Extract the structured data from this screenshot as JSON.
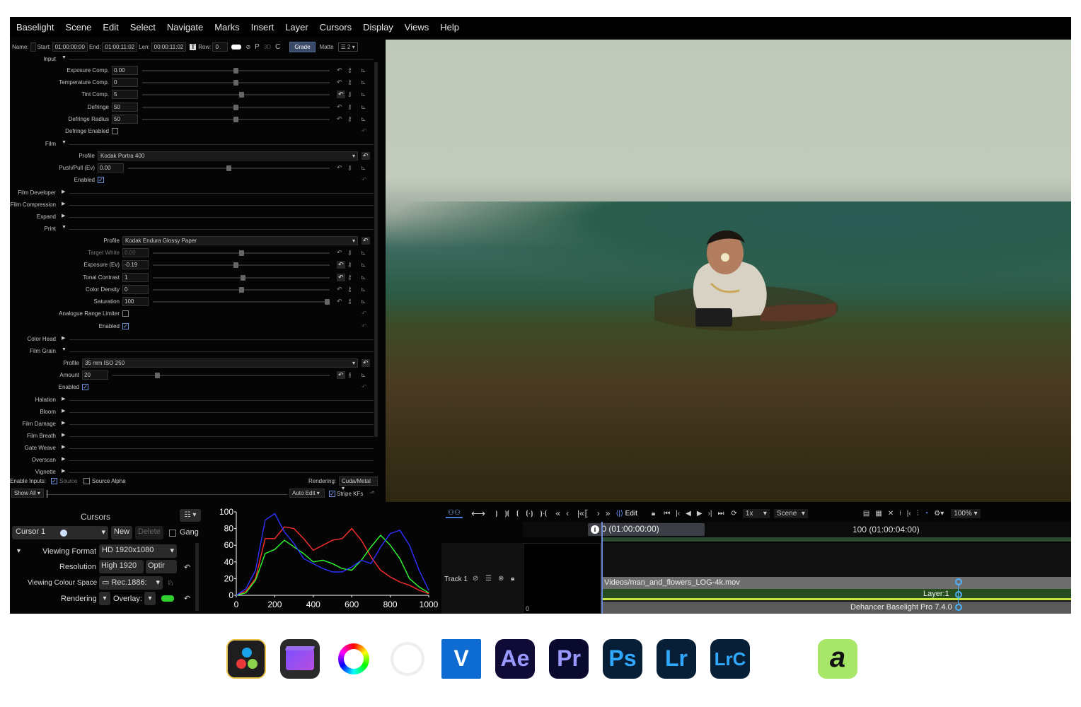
{
  "menu": [
    "Baselight",
    "Scene",
    "Edit",
    "Select",
    "Navigate",
    "Marks",
    "Insert",
    "Layer",
    "Cursors",
    "Display",
    "Views",
    "Help"
  ],
  "toolbar": {
    "name_label": "Name:",
    "start_label": "Start:",
    "start": "01:00:00:00",
    "end_label": "End:",
    "end": "01:00:11:02",
    "len_label": "Len:",
    "len": "00:00:11:02",
    "row_label": "Row:",
    "row": "0",
    "p": "P",
    "three_d": "3D",
    "c": "C",
    "grade": "Grade",
    "matte": "Matte",
    "count": "2"
  },
  "rows": [
    {
      "type": "section",
      "label": "Input",
      "open": true,
      "y": 0
    },
    {
      "type": "param",
      "label": "Exposure Comp.",
      "value": "0.00",
      "knob": 0.5,
      "y": 16,
      "lx": 140,
      "reset_on": false
    },
    {
      "type": "param",
      "label": "Temperature Comp.",
      "value": "0",
      "knob": 0.5,
      "y": 33,
      "lx": 140,
      "reset_on": false
    },
    {
      "type": "param",
      "label": "Tint Comp.",
      "value": "5",
      "knob": 0.53,
      "y": 50,
      "lx": 140,
      "reset_on": true
    },
    {
      "type": "param",
      "label": "Defringe",
      "value": "50",
      "knob": 0.5,
      "y": 68,
      "lx": 140,
      "reset_on": false
    },
    {
      "type": "param",
      "label": "Defringe Radius",
      "value": "50",
      "knob": 0.5,
      "y": 85,
      "lx": 140,
      "reset_on": false
    },
    {
      "type": "check",
      "label": "Defringe Enabled",
      "checked": false,
      "y": 102,
      "lx": 140
    },
    {
      "type": "section",
      "label": "Film",
      "open": true,
      "y": 120
    },
    {
      "type": "select",
      "label": "Profile",
      "value": "Kodak Portra 400",
      "y": 137,
      "lx": 120
    },
    {
      "type": "param",
      "label": "Push/Pull (Ev)",
      "value": "0.00",
      "knob": 0.5,
      "y": 154,
      "lx": 120,
      "reset_on": false
    },
    {
      "type": "check",
      "label": "Enabled",
      "checked": true,
      "y": 171,
      "lx": 120
    },
    {
      "type": "section",
      "label": "Film Developer",
      "open": false,
      "y": 189
    },
    {
      "type": "section",
      "label": "Film Compression",
      "open": false,
      "y": 206
    },
    {
      "type": "section",
      "label": "Expand",
      "open": false,
      "y": 223
    },
    {
      "type": "section",
      "label": "Print",
      "open": true,
      "y": 240
    },
    {
      "type": "select",
      "label": "Profile",
      "value": "Kodak Endura Glossy Paper",
      "y": 257,
      "lx": 155
    },
    {
      "type": "param",
      "label": "Target White",
      "value": "0.00",
      "knob": 0.5,
      "y": 274,
      "lx": 155,
      "reset_on": false,
      "dim": true
    },
    {
      "type": "param",
      "label": "Exposure (Ev)",
      "value": "-0.19",
      "knob": 0.47,
      "y": 291,
      "lx": 155,
      "reset_on": true
    },
    {
      "type": "param",
      "label": "Tonal Contrast",
      "value": "1",
      "knob": 0.51,
      "y": 309,
      "lx": 155,
      "reset_on": true
    },
    {
      "type": "param",
      "label": "Color Density",
      "value": "0",
      "knob": 0.5,
      "y": 326,
      "lx": 155,
      "reset_on": false
    },
    {
      "type": "param",
      "label": "Saturation",
      "value": "100",
      "knob": 1.0,
      "y": 343,
      "lx": 155,
      "reset_on": false
    },
    {
      "type": "check",
      "label": "Analogue Range Limiter",
      "checked": false,
      "y": 360,
      "lx": 155
    },
    {
      "type": "check",
      "label": "Enabled",
      "checked": true,
      "y": 378,
      "lx": 155
    },
    {
      "type": "section",
      "label": "Color Head",
      "open": false,
      "y": 396
    },
    {
      "type": "section",
      "label": "Film Grain",
      "open": true,
      "y": 413
    },
    {
      "type": "select",
      "label": "Profile",
      "value": "35 mm ISO 250",
      "y": 430,
      "lx": 98
    },
    {
      "type": "param",
      "label": "Amount",
      "value": "20",
      "knob": 0.2,
      "y": 447,
      "lx": 98,
      "reset_on": true
    },
    {
      "type": "check",
      "label": "Enabled",
      "checked": true,
      "y": 464,
      "lx": 98
    },
    {
      "type": "section",
      "label": "Halation",
      "open": false,
      "y": 482
    },
    {
      "type": "section",
      "label": "Bloom",
      "open": false,
      "y": 499
    },
    {
      "type": "section",
      "label": "Film Damage",
      "open": false,
      "y": 516
    },
    {
      "type": "section",
      "label": "Film Breath",
      "open": false,
      "y": 533
    },
    {
      "type": "section",
      "label": "Gate Weave",
      "open": false,
      "y": 550
    },
    {
      "type": "section",
      "label": "Overscan",
      "open": false,
      "y": 567
    },
    {
      "type": "section",
      "label": "Vignette",
      "open": false,
      "y": 584
    }
  ],
  "bottom": {
    "enable_inputs": "Enable Inputs:",
    "source": "Source",
    "source_alpha": "Source Alpha",
    "rendering_label": "Rendering:",
    "rendering": "Cuda/Metal",
    "show_all": "Show All",
    "auto_edit": "Auto Edit",
    "stripe": "Stripe KFs"
  },
  "cursors": {
    "title": "Cursors",
    "cursor": "Cursor 1",
    "new": "New",
    "delete": "Delete",
    "gang": "Gang",
    "viewing_format_label": "Viewing Format",
    "viewing_format": "HD 1920x1080",
    "resolution_label": "Resolution",
    "resolution": "High 1920",
    "resolution_opt": "Optir",
    "colour_space_label": "Viewing Colour Space",
    "colour_space": "Rec.1886:",
    "rendering_label": "Rendering",
    "overlay_label": "Overlay:"
  },
  "histogram": {
    "y_ticks": [
      "100",
      "80",
      "60",
      "40",
      "20",
      "0"
    ],
    "x_ticks": [
      "0",
      "200",
      "400",
      "600",
      "800",
      "1000"
    ]
  },
  "chart_data": {
    "type": "line",
    "x": [
      0,
      50,
      100,
      150,
      200,
      250,
      300,
      350,
      400,
      450,
      500,
      550,
      600,
      650,
      700,
      750,
      800,
      850,
      900,
      950,
      1000
    ],
    "series": [
      {
        "color": "#ff3030",
        "values": [
          0,
          5,
          20,
          68,
          68,
          82,
          80,
          68,
          54,
          60,
          66,
          68,
          80,
          66,
          46,
          30,
          22,
          16,
          12,
          6,
          2
        ]
      },
      {
        "color": "#30ff30",
        "values": [
          0,
          3,
          18,
          50,
          55,
          66,
          58,
          50,
          40,
          42,
          38,
          32,
          30,
          42,
          58,
          72,
          60,
          44,
          20,
          10,
          3
        ]
      },
      {
        "color": "#3030ff",
        "values": [
          0,
          8,
          30,
          90,
          98,
          76,
          62,
          44,
          38,
          32,
          28,
          28,
          34,
          42,
          38,
          58,
          74,
          78,
          60,
          30,
          6
        ]
      }
    ],
    "xlim": [
      0,
      1000
    ],
    "ylim": [
      0,
      100
    ]
  },
  "timeline": {
    "edit": "Edit",
    "speed": "1x",
    "scene": "Scene",
    "zoom": "100%",
    "start": "0 (01:00:00:00)",
    "mid": "100 (01:00:04:00)",
    "track": "Track 1",
    "frame": "0",
    "clip": "Videos/man_and_flowers_LOG-4k.mov",
    "layer": "Layer:1",
    "effect": "Dehancer Baselight Pro 7.4.0"
  },
  "dock": [
    {
      "name": "DaVinci Resolve",
      "icon": "davinci-resolve-icon",
      "x": 320,
      "bg": "#1e1e1e",
      "txt": ""
    },
    {
      "name": "Final Cut Pro",
      "icon": "final-cut-pro-icon",
      "x": 396,
      "bg": "#2a2a2a",
      "txt": ""
    },
    {
      "name": "Color wheel",
      "icon": "color-wheel-icon",
      "x": 472,
      "bg": "#fff",
      "txt": ""
    },
    {
      "name": "White ring",
      "icon": "white-ring-icon",
      "x": 548,
      "bg": "#fff",
      "txt": ""
    },
    {
      "name": "Vegas",
      "icon": "vegas-icon",
      "x": 624,
      "bg": "#0d6bd1",
      "txt": "V"
    },
    {
      "name": "After Effects",
      "icon": "after-effects-icon",
      "x": 700,
      "bg": "#0f0a36",
      "txt": "Ae"
    },
    {
      "name": "Premiere Pro",
      "icon": "premiere-pro-icon",
      "x": 776,
      "bg": "#0a0a2f",
      "txt": "Pr"
    },
    {
      "name": "Photoshop",
      "icon": "photoshop-icon",
      "x": 852,
      "bg": "#061e36",
      "txt": "Ps"
    },
    {
      "name": "Lightroom",
      "icon": "lightroom-icon",
      "x": 928,
      "bg": "#061e36",
      "txt": "Lr"
    },
    {
      "name": "Lightroom Classic",
      "icon": "lightroom-classic-icon",
      "x": 1004,
      "bg": "#061e36",
      "txt": "LrC"
    },
    {
      "name": "Dehancer",
      "icon": "dehancer-icon",
      "x": 1156,
      "bg": "#a8e66a",
      "txt": "a"
    }
  ]
}
